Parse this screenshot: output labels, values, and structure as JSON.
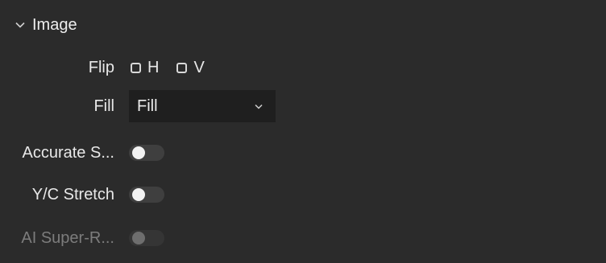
{
  "section": {
    "title": "Image",
    "expanded_icon": "chevron-down-icon"
  },
  "flip": {
    "label": "Flip",
    "h_label": "H",
    "v_label": "V",
    "h_checked": false,
    "v_checked": false
  },
  "fill": {
    "label": "Fill",
    "selected": "Fill"
  },
  "accurate": {
    "label": "Accurate S...",
    "enabled": false
  },
  "yc_stretch": {
    "label": "Y/C Stretch",
    "enabled": false
  },
  "ai_super": {
    "label": "AI Super-R...",
    "enabled": false,
    "disabled": true
  },
  "colors": {
    "background": "#2b2b2b",
    "select_bg": "#1f1f1f",
    "toggle_track": "#3f3f3f",
    "toggle_knob": "#f2f2f2",
    "disabled_text": "#7c7c7c"
  }
}
